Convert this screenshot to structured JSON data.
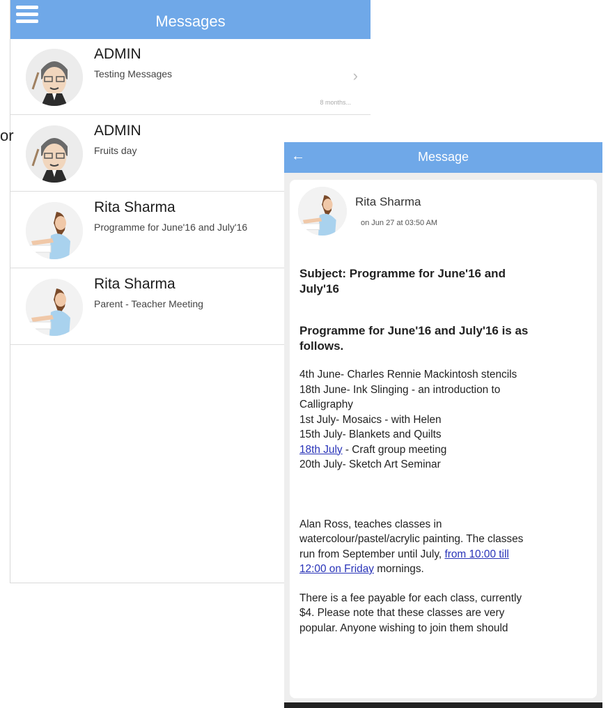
{
  "list_screen": {
    "title": "Messages",
    "edge_text": "or",
    "rows": [
      {
        "name": "ADMIN",
        "subtitle": "Testing Messages",
        "time": "8 months...",
        "avatar": "admin-cartoon-avatar"
      },
      {
        "name": "ADMIN",
        "subtitle": "Fruits day",
        "avatar": "admin-cartoon-avatar"
      },
      {
        "name": "Rita Sharma",
        "subtitle": "Programme for June'16 and July'16",
        "avatar": "teacher-photo-avatar"
      },
      {
        "name": "Rita Sharma",
        "subtitle": "Parent - Teacher Meeting",
        "avatar": "teacher-photo-avatar"
      }
    ]
  },
  "detail_screen": {
    "title": "Message",
    "sender": "Rita Sharma",
    "sent_time": "on Jun 27 at 03:50 AM",
    "subject_line_1": "Subject: Programme for June'16 and",
    "subject_line_2": "July'16",
    "heading_line_1": "Programme for June'16 and July'16 is as",
    "heading_line_2": "follows.",
    "programme": [
      "4th June- Charles Rennie Mackintosh stencils",
      "18th June- Ink Slinging - an introduction to",
      "Calligraphy",
      "1st July- Mosaics - with Helen",
      "15th July- Blankets and Quilts"
    ],
    "link_item_link": "18th July",
    "link_item_rest": " - Craft group meeting",
    "last_item": "20th July- Sketch Art Seminar",
    "para1_line1": "Alan Ross, teaches classes in",
    "para1_line2": "watercolour/pastel/acrylic painting. The classes",
    "para1_line3_pre": "run from September until July, ",
    "para1_link_a": "from 10:00 till",
    "para1_link_b": "12:00 on Friday",
    "para1_line4_post": " mornings.",
    "para2_line1": "There is a fee payable for each class, currently",
    "para2_line2": "$4. Please note that these classes are very",
    "para2_line3": "popular. Anyone wishing to join them should"
  },
  "colors": {
    "header_blue": "#6fa8e8",
    "link_blue": "#2833b8"
  }
}
